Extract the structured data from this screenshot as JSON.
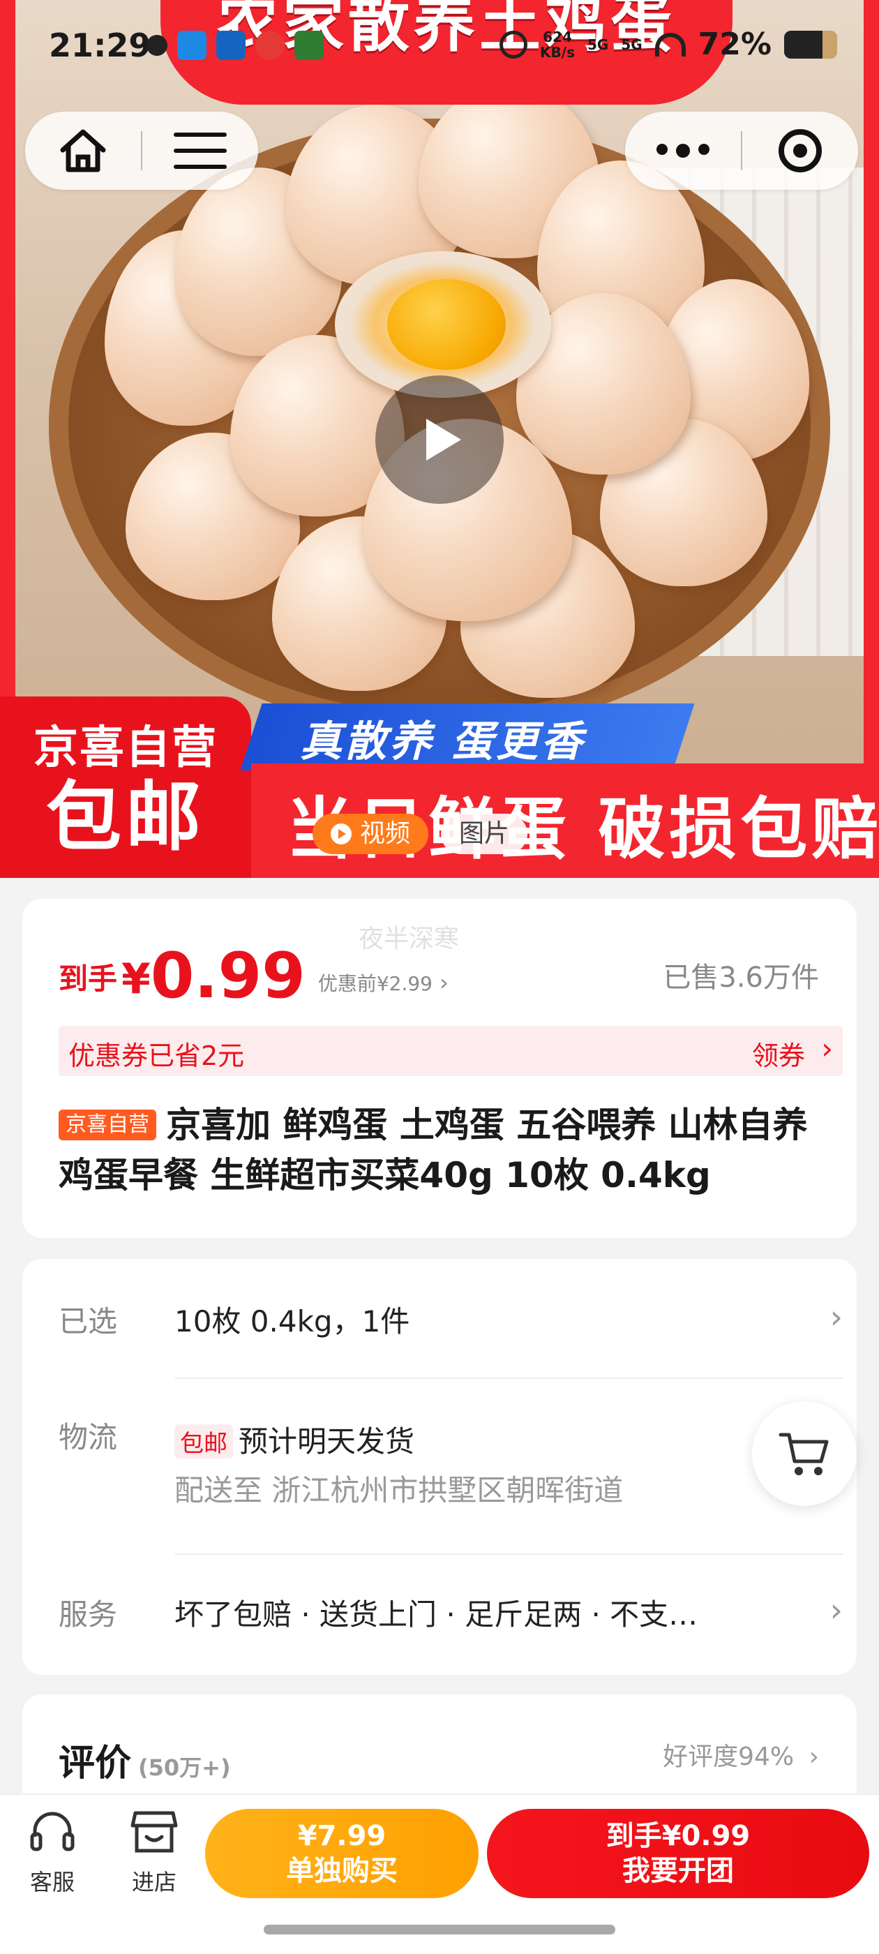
{
  "status_bar": {
    "time": "21:29",
    "net_speed": "624\nKB/s",
    "signal_1": "5G",
    "signal_2": "5G",
    "battery": "72%"
  },
  "hero": {
    "top_banner": "农家散养土鸡蛋",
    "badge_line1": "京喜自营",
    "badge_line2": "包邮",
    "slogan": "真散养 蛋更香",
    "strip_text": "当日鲜蛋 破损包赔",
    "tabs": [
      "视频",
      "图片"
    ]
  },
  "price_card": {
    "watermark": "夜半深寒",
    "prefix": "到手",
    "currency": "¥",
    "price": "0.99",
    "original": "优惠前¥2.99",
    "sold": "已售3.6万件",
    "coupon_saved": "优惠券已省2元",
    "coupon_get": "领券",
    "tag": "京喜自营",
    "title": "京喜加 鲜鸡蛋 土鸡蛋 五谷喂养 山林自养鸡蛋早餐 生鲜超市买菜40g 10枚 0.4kg"
  },
  "specs": {
    "selected_label": "已选",
    "selected_value": "10枚 0.4kg，1件",
    "logistics_label": "物流",
    "free_tag": "包邮",
    "ship_time": "预计明天发货",
    "ship_addr": "配送至 浙江杭州市拱墅区朝晖街道",
    "service_label": "服务",
    "service_value": "坏了包赔 · 送货上门 · 足斤足两 · 不支…"
  },
  "reviews": {
    "title": "评价",
    "count": "(50万+)",
    "rate": "好评度94%"
  },
  "action_bar": {
    "service": "客服",
    "store": "进店",
    "solo_price": "¥7.99",
    "solo_label": "单独购买",
    "group_price": "到手¥0.99",
    "group_label": "我要开团"
  },
  "colors": {
    "accent_red": "#e8121d",
    "orange": "#ffa000",
    "brand_blue": "#1b4fd6"
  },
  "icons": [
    "home-icon",
    "menu-icon",
    "more-icon",
    "record-icon",
    "play-icon",
    "cart-icon",
    "headset-icon",
    "store-icon"
  ]
}
